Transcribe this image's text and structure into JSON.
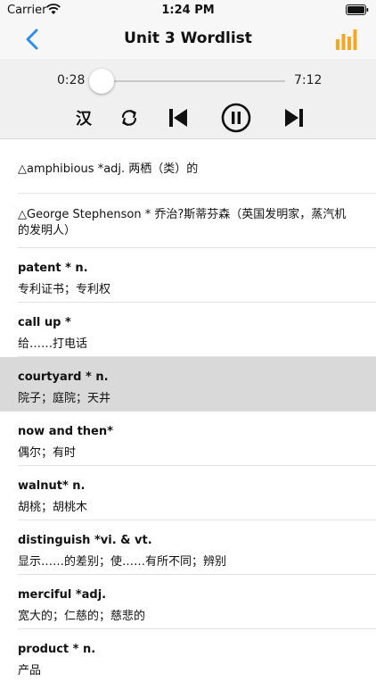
{
  "status_bar": {
    "carrier": "Carrier",
    "time": "1:24 PM"
  },
  "nav": {
    "title": "Unit 3 Wordlist",
    "accent_color": "#2f8de4",
    "stats_color": "#f5a623"
  },
  "player": {
    "current_time": "0:28",
    "total_time": "7:12",
    "progress_fraction": 0.065,
    "language_toggle_label": "汉"
  },
  "words": [
    {
      "single": "△amphibious  *adj.  两栖（类）的"
    },
    {
      "single": "△George Stephenson * 乔治?斯蒂芬森（英国发明家，蒸汽机的发明人）"
    },
    {
      "word": "patent * n.",
      "meaning": "专利证书；专利权"
    },
    {
      "word": "call up  *",
      "meaning": "给……打电话"
    },
    {
      "word": "courtyard * n.",
      "meaning": "院子；庭院；天井",
      "selected": true
    },
    {
      "word": "now and then*",
      "meaning": "偶尔；有时"
    },
    {
      "word": "walnut*  n.",
      "meaning": "胡桃；胡桃木"
    },
    {
      "word": "distinguish  *vi. & vt.",
      "meaning": "显示……的差别；使……有所不同；辨别"
    },
    {
      "word": "merciful  *adj.",
      "meaning": "宽大的；仁慈的；慈悲的"
    },
    {
      "word": "product * n.",
      "meaning": "产品"
    }
  ]
}
